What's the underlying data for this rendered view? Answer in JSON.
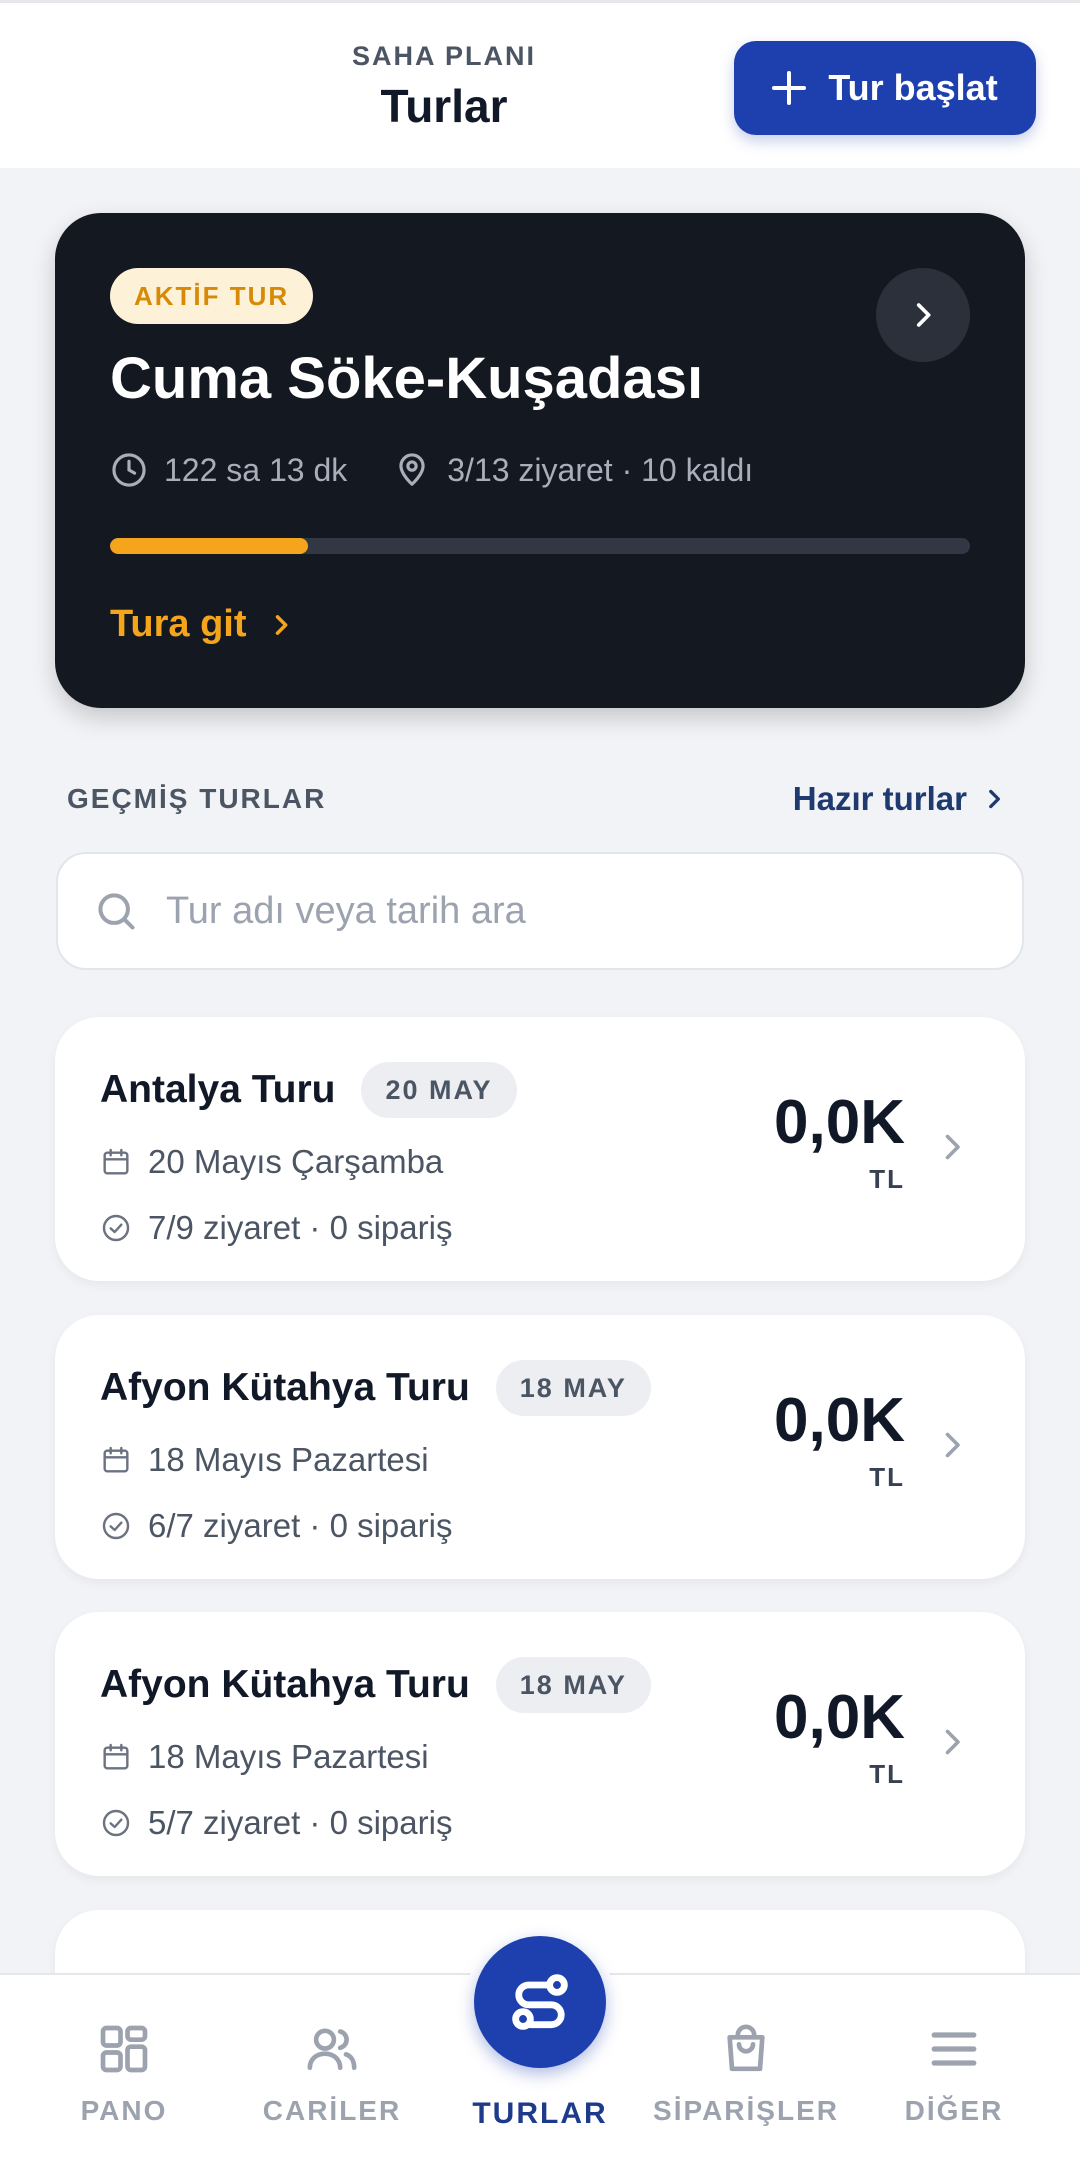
{
  "header": {
    "eyebrow": "SAHA PLANI",
    "title": "Turlar",
    "start_button_label": "Tur başlat"
  },
  "active_tour": {
    "badge": "AKTİF TUR",
    "title": "Cuma Söke-Kuşadası",
    "duration": "122 sa 13 dk",
    "visits": "3/13 ziyaret · 10 kaldı",
    "progress_fraction": 0.23,
    "goto_label": "Tura git"
  },
  "past_tours": {
    "section_label": "GEÇMİŞ TURLAR",
    "ready_link": "Hazır turlar",
    "search_placeholder": "Tur adı veya tarih ara",
    "items": [
      {
        "name": "Antalya Turu",
        "badge": "20 MAY",
        "date": "20 Mayıs Çarşamba",
        "stats": "7/9 ziyaret · 0 sipariş",
        "amount": "0,0K",
        "currency": "TL"
      },
      {
        "name": "Afyon Kütahya Turu",
        "badge": "18 MAY",
        "date": "18 Mayıs Pazartesi",
        "stats": "6/7 ziyaret · 0 sipariş",
        "amount": "0,0K",
        "currency": "TL"
      },
      {
        "name": "Afyon Kütahya Turu",
        "badge": "18 MAY",
        "date": "18 Mayıs Pazartesi",
        "stats": "5/7 ziyaret · 0 sipariş",
        "amount": "0,0K",
        "currency": "TL"
      }
    ]
  },
  "bottom_nav": {
    "items": [
      {
        "label": "PANO",
        "icon": "dashboard-icon"
      },
      {
        "label": "CARİLER",
        "icon": "users-icon"
      },
      {
        "label": "TURLAR",
        "icon": "route-icon",
        "active": true
      },
      {
        "label": "SİPARİŞLER",
        "icon": "shopping-bag-icon"
      },
      {
        "label": "DİĞER",
        "icon": "menu-icon"
      }
    ]
  },
  "colors": {
    "primary": "#1e40af",
    "accent": "#f5a51b",
    "dark_card": "#141821",
    "background": "#f1f3f6"
  }
}
